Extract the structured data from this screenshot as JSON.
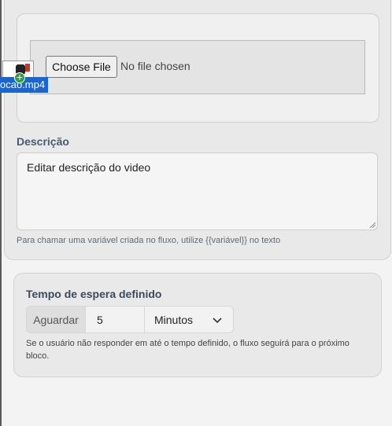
{
  "upload": {
    "choose_label": "Choose File",
    "status_text": "No file chosen",
    "dragged_file_name": "ocao.mp4",
    "drag_icon": "video-file-icon",
    "drop_badge": "+"
  },
  "description": {
    "label": "Descrição",
    "value": "Editar descrição do video",
    "hint": "Para chamar uma variável criada no fluxo, utilize {{variável}} no texto"
  },
  "wait": {
    "title": "Tempo de espera definido",
    "addon_label": "Aguardar",
    "amount": "5",
    "unit": "Minutos",
    "hint": "Se o usuário não responder em até o tempo definido, o fluxo seguirá para o próximo bloco."
  },
  "colors": {
    "drag_label_bg": "#1a66cc",
    "drop_badge": "#2e9e44",
    "card_bg": "#e9e9e9"
  }
}
